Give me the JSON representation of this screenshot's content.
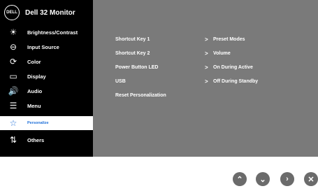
{
  "header": {
    "logo_text": "DELL",
    "title": "Dell 32 Monitor"
  },
  "sidebar": {
    "items": [
      {
        "label": "Brightness/Contrast",
        "icon": "brightness-icon",
        "glyph": "☀"
      },
      {
        "label": "Input Source",
        "icon": "input-source-icon",
        "glyph": "⊖"
      },
      {
        "label": "Color",
        "icon": "color-icon",
        "glyph": "⟳"
      },
      {
        "label": "Display",
        "icon": "display-icon",
        "glyph": "▭"
      },
      {
        "label": "Audio",
        "icon": "audio-icon",
        "glyph": "🔊"
      },
      {
        "label": "Menu",
        "icon": "menu-icon",
        "glyph": "☰"
      },
      {
        "label": "Personalize",
        "icon": "star-icon",
        "glyph": "☆",
        "active": true
      },
      {
        "label": "Others",
        "icon": "others-icon",
        "glyph": "⇅"
      }
    ]
  },
  "settings": [
    {
      "key": "Shortcut Key 1",
      "value": "Preset Modes"
    },
    {
      "key": "Shortcut Key 2",
      "value": "Volume"
    },
    {
      "key": "Power Button LED",
      "value": "On During Active"
    },
    {
      "key": "USB",
      "value": "Off During Standby"
    },
    {
      "key": "Reset Personalization",
      "value": ""
    }
  ],
  "nav_buttons": [
    {
      "name": "up-button",
      "glyph": "⌃"
    },
    {
      "name": "down-button",
      "glyph": "⌄"
    },
    {
      "name": "right-button",
      "glyph": "›"
    },
    {
      "name": "close-button",
      "glyph": "✕"
    }
  ],
  "colors": {
    "panel": "#7a7a7a",
    "sidebar": "#000000",
    "highlight": "#1e6fd9"
  }
}
